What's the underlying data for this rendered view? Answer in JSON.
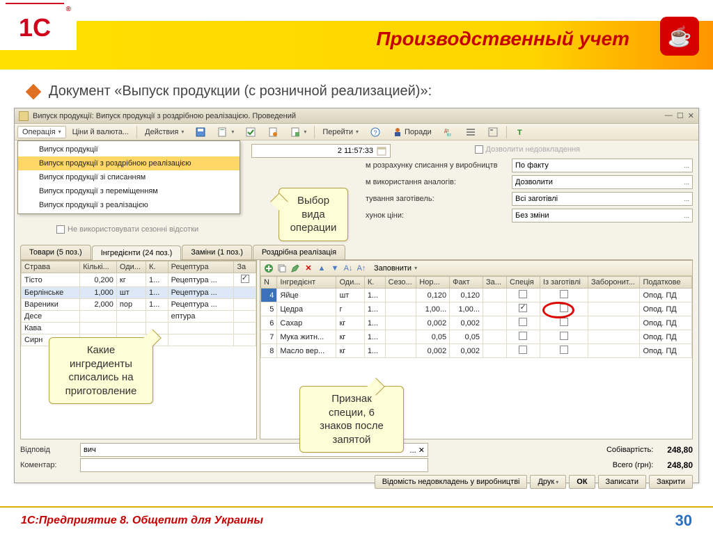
{
  "slide": {
    "logo_text": "1С",
    "title": "Производственный учет",
    "subtitle": "Документ «Выпуск продукции (с розничной реализацией)»:",
    "footer": "1С:Предприятие 8. Общепит для Украины",
    "page": "30"
  },
  "window": {
    "title": "Випуск продукції: Випуск продукції з роздрібною реалізацією. Проведений"
  },
  "toolbar": {
    "operation": "Операція",
    "prices": "Ціни й валюта...",
    "actions": "Действия",
    "goto": "Перейти",
    "advice": "Поради"
  },
  "dropdown": {
    "items": [
      "Випуск продукції",
      "Випуск продукції з роздрібною реалізацією",
      "Випуск продукції зі списанням",
      "Випуск продукції з переміщенням",
      "Випуск продукції з реалізацією"
    ],
    "selected_index": 1
  },
  "form": {
    "date_value": "2 11:57:33",
    "allow_under": "Дозволити недовкладення",
    "labels": {
      "l1": "м розрахунку списання у виробництв",
      "l2": "м використання аналогів:",
      "l3": "тування заготівель:",
      "l4": "хунок ціни:"
    },
    "values": {
      "v1": "По факту",
      "v2": "Дозволити",
      "v3": "Всі заготівлі",
      "v4": "Без зміни"
    },
    "seasonal": "Не використовувати сезонні відсотки"
  },
  "tabs": {
    "t1": "Товари (5 поз.)",
    "t2": "Інгредієнти (24 поз.)",
    "t3": "Заміни (1 поз.)",
    "t4": "Роздрібна реалізація"
  },
  "left_table": {
    "headers": [
      "Страва",
      "Кількі...",
      "Оди...",
      "К.",
      "Рецептура",
      "За"
    ],
    "rows": [
      {
        "c": [
          "Тісто",
          "0,200",
          "кг",
          "1...",
          "Рецептура ...",
          "✓"
        ]
      },
      {
        "c": [
          "Берлінське",
          "1,000",
          "шт",
          "1...",
          "Рецептура ...",
          ""
        ]
      },
      {
        "c": [
          "Вареники",
          "2,000",
          "пор",
          "1...",
          "Рецептура ...",
          ""
        ]
      },
      {
        "c": [
          "Десе",
          "",
          "",
          "",
          "ептура",
          ""
        ]
      },
      {
        "c": [
          "Кава",
          "",
          "",
          "",
          "",
          ""
        ]
      },
      {
        "c": [
          "Сирн",
          "",
          "",
          "",
          "",
          ""
        ]
      }
    ]
  },
  "right_toolbar": {
    "fill": "Заповнити"
  },
  "right_table": {
    "headers": [
      "N",
      "Інгредієнт",
      "Оди...",
      "К.",
      "Сезо...",
      "Нор...",
      "Факт",
      "За...",
      "Спеція",
      "Із заготівлі",
      "Заборонит...",
      "Податкове"
    ],
    "rows": [
      {
        "n": "4",
        "name": "Яйце",
        "uom": "шт",
        "k": "1...",
        "sezo": "",
        "nor": "0,120",
        "fact": "0,120",
        "za": "",
        "spice": false,
        "zag": false,
        "forb": "",
        "tax": "Опод. ПД"
      },
      {
        "n": "5",
        "name": "Цедра",
        "uom": "г",
        "k": "1...",
        "sezo": "",
        "nor": "1,00...",
        "fact": "1,00...",
        "za": "",
        "spice": true,
        "zag": false,
        "forb": "",
        "tax": "Опод. ПД"
      },
      {
        "n": "6",
        "name": "Сахар",
        "uom": "кг",
        "k": "1...",
        "sezo": "",
        "nor": "0,002",
        "fact": "0,002",
        "za": "",
        "spice": false,
        "zag": false,
        "forb": "",
        "tax": "Опод. ПД"
      },
      {
        "n": "7",
        "name": "Мука житн...",
        "uom": "кг",
        "k": "1...",
        "sezo": "",
        "nor": "0,05",
        "fact": "0,05",
        "za": "",
        "spice": false,
        "zag": false,
        "forb": "",
        "tax": "Опод. ПД"
      },
      {
        "n": "8",
        "name": "Масло вер...",
        "uom": "кг",
        "k": "1...",
        "sezo": "",
        "nor": "0,002",
        "fact": "0,002",
        "za": "",
        "spice": false,
        "zag": false,
        "forb": "",
        "tax": "Опод. ПД"
      }
    ]
  },
  "footer": {
    "resp_label": "Відповід",
    "resp_value": "вич",
    "comment_label": "Коментар:",
    "cost_label": "Собівартість:",
    "total_label": "Всего (грн):",
    "cost_value": "248,80",
    "total_value": "248,80",
    "btn_report": "Відомість недовкладень у виробництві",
    "btn_print": "Друк",
    "btn_ok": "ОК",
    "btn_write": "Записати",
    "btn_close": "Закрити"
  },
  "callouts": {
    "c1": "Выбор\nвида\nоперации",
    "c2": "Какие\nингредиенты\nсписались на\nприготовление",
    "c3": "Признак\nспеции, 6\nзнаков после\nзапятой"
  }
}
